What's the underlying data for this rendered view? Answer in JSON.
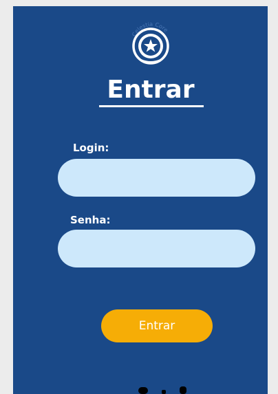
{
  "logo": {
    "icon": "star-badge-icon",
    "arc_text": "Celestia Core"
  },
  "title": "Entrar",
  "form": {
    "login_label": "Login:",
    "login_value": "",
    "senha_label": "Senha:",
    "senha_value": "",
    "submit_label": "Entrar"
  },
  "colors": {
    "panel": "#1a4988",
    "field": "#cde8fb",
    "button": "#f6ad06",
    "text": "#ffffff"
  }
}
